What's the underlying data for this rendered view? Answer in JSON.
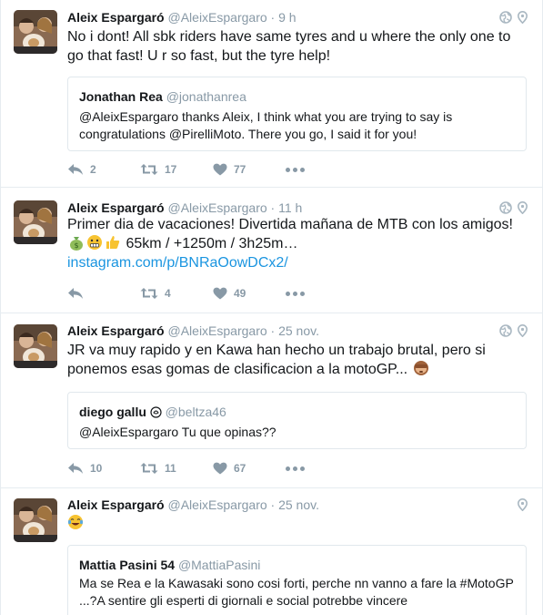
{
  "tweets": [
    {
      "name": "Aleix Espargaró",
      "username": "@AleixEspargaro",
      "time": "· 9 h",
      "text": "No i dont! All sbk riders have same tyres and u where the only one to go that fast! U r so fast, but the tyre help!",
      "quote": {
        "name": "Jonathan Rea",
        "username": "@jonathanrea",
        "text": "@AleixEspargaro thanks Aleix, I think what you are trying to say is congratulations @PirelliMoto. There you go, I said it for you!"
      },
      "replies": "2",
      "retweets": "17",
      "likes": "77"
    },
    {
      "name": "Aleix Espargaró",
      "username": "@AleixEspargaro",
      "time": "· 11 h",
      "text_before": "Primer dia de vacaciones! Divertida mañana de MTB con los amigos!",
      "text_after": "65km / +1250m / 3h25m…",
      "link": "instagram.com/p/BNRaOowDCx2/",
      "replies": "",
      "retweets": "4",
      "likes": "49"
    },
    {
      "name": "Aleix Espargaró",
      "username": "@AleixEspargaro",
      "time": "· 25 nov.",
      "text": "JR va muy rapido y en Kawa han hecho un trabajo brutal, pero si ponemos esas gomas de clasificacion a la motoGP...",
      "quote": {
        "name": "diego gallu",
        "username": "@beltza46",
        "text": "@AleixEspargaro Tu que opinas??"
      },
      "replies": "10",
      "retweets": "11",
      "likes": "67"
    },
    {
      "name": "Aleix Espargaró",
      "username": "@AleixEspargaro",
      "time": "· 25 nov.",
      "text": "",
      "quote": {
        "name": "Mattia Pasini 54",
        "username": "@MattiaPasini",
        "text": "Ma se Rea e la Kawasaki sono cosi forti, perche nn vanno a fare la #MotoGP ...?A sentire gli esperti di giornali e social potrebbe vincere"
      }
    }
  ],
  "icons": {
    "reply": "reply-icon",
    "retweet": "retweet-icon",
    "like": "heart-icon",
    "more": "more-dots-icon",
    "globe": "globe-icon",
    "location": "location-pin-icon"
  },
  "colors": {
    "muted": "#8899a6",
    "link": "#1b95e0",
    "border": "#e6ecf0"
  }
}
